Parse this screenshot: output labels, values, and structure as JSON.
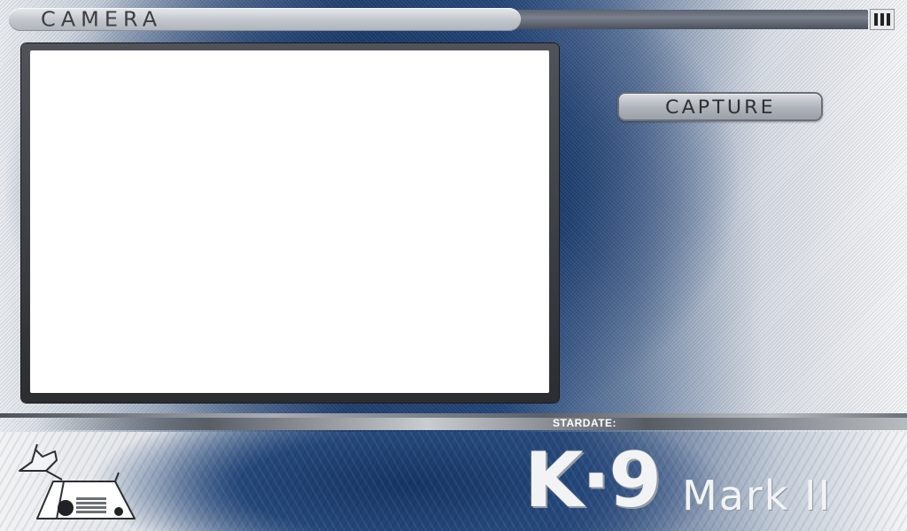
{
  "title_bar": {
    "title": "CAMERA",
    "menu_icon": "menu-bars-icon"
  },
  "camera": {
    "view_state": "blank"
  },
  "actions": {
    "capture_label": "CAPTURE"
  },
  "status": {
    "stardate_label": "STARDATE:",
    "stardate_value": ""
  },
  "branding": {
    "logo_main": "K·9",
    "logo_sub": "Mark II",
    "mascot_icon": "k9-robot-dog-icon"
  },
  "colors": {
    "background_blue": "#1b3b6b",
    "panel_gray": "#aeb3ba",
    "text_dark": "#3c3e42"
  }
}
